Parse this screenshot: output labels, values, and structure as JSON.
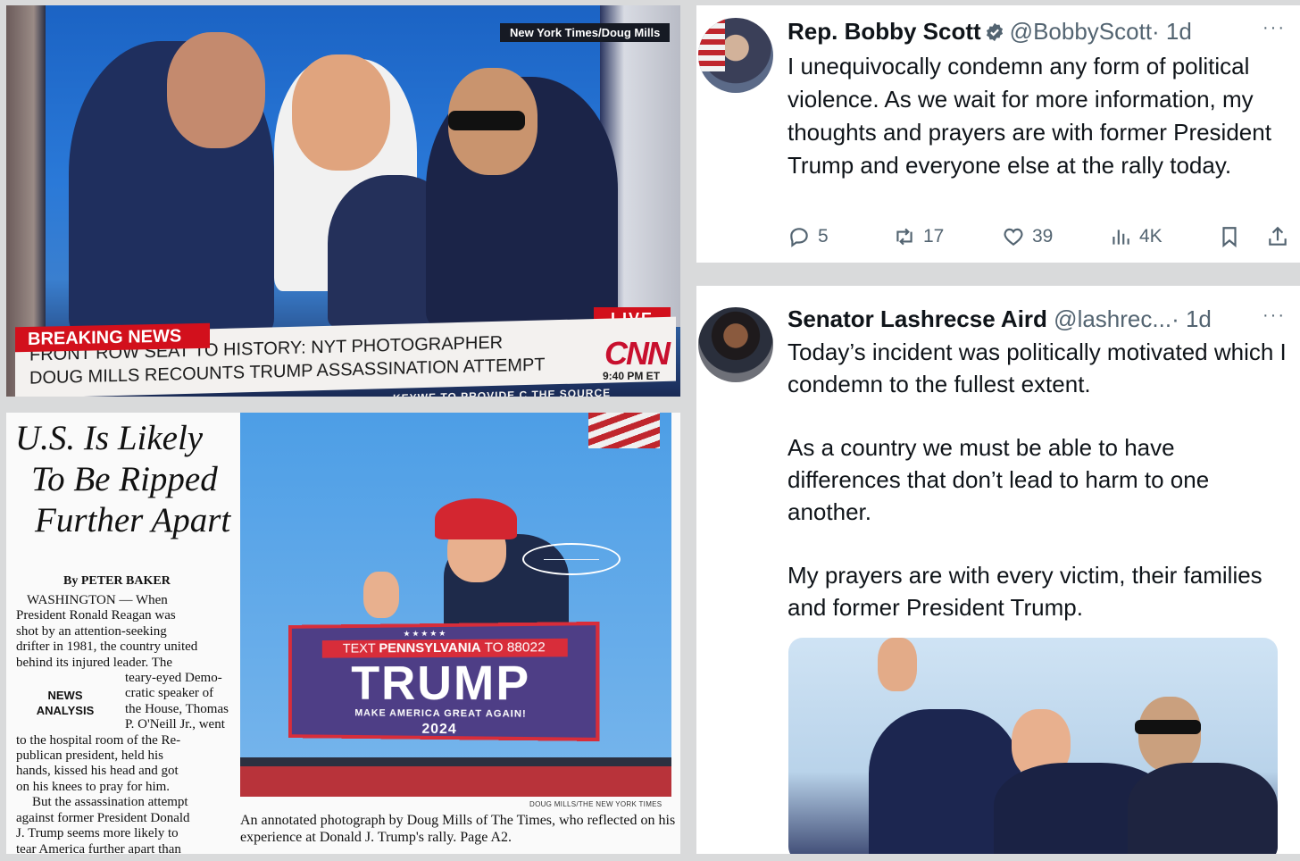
{
  "tv": {
    "credit": "New York Times/Doug Mills",
    "live": "LIVE",
    "breaking": "BREAKING NEWS",
    "headline_1": "FRONT ROW SEAT TO HISTORY: NYT PHOTOGRAPHER",
    "headline_2": "DOUG MILLS RECOUNTS TRUMP ASSASSINATION ATTEMPT",
    "network": "CNN",
    "time": "9:40 PM ET",
    "ticker": "…KEYWE TO PROVIDE C THE SOURCE"
  },
  "paper": {
    "headline": [
      "U.S. Is Likely",
      "To Be Ripped",
      "Further Apart"
    ],
    "byline": "By PETER BAKER",
    "section_tag": [
      "NEWS",
      "ANALYSIS"
    ],
    "body": [
      "WASHINGTON — When",
      "President Ronald Reagan was",
      "shot by an attention-seeking",
      "drifter in 1981, the country united",
      "behind its injured leader. The",
      "teary-eyed Demo-",
      "cratic speaker of",
      "the House, Thomas",
      "P. O'Neill Jr., went",
      "to the hospital room of the Re-",
      "publican president, held his",
      "hands, kissed his head and got",
      "on his knees to pray for him.",
      "But the assassination attempt",
      "against former President Donald",
      "J. Trump seems more likely to",
      "tear America further apart than"
    ],
    "podium": {
      "stars": "★★★★★",
      "text_prefix": "TEXT ",
      "text_state": "PENNSYLVANIA",
      "text_suffix": " TO 88022",
      "name": "TRUMP",
      "slogan": "MAKE AMERICA GREAT AGAIN!",
      "year": "2024"
    },
    "photo_credit": "DOUG MILLS/THE NEW YORK TIMES",
    "caption": "An annotated photograph by Doug Mills of The Times, who reflected on his experience at Donald J. Trump's rally. Page A2."
  },
  "tweets": [
    {
      "name": "Rep. Bobby Scott",
      "verified": true,
      "handle": "@BobbyScott",
      "time": "· 1d",
      "more": "···",
      "text": [
        "I unequivocally condemn any form of political violence. As we wait for more information, my thoughts and prayers are with former President Trump and everyone else at the rally today."
      ],
      "replies": "5",
      "reposts": "17",
      "likes": "39",
      "views": "4K"
    },
    {
      "name": "Senator Lashrecse Aird",
      "verified": false,
      "handle": "@lashrec...",
      "time": "· 1d",
      "more": "···",
      "text": [
        "Today’s incident was politically motivated which I condemn to the fullest extent.",
        "As a country we must be able to have differences that don’t lead to harm to one another.",
        "My prayers are with every victim, their families and former President Trump."
      ]
    }
  ],
  "colors": {
    "cnn_red": "#d2101c",
    "podium_blue": "#4e3e86",
    "x_gray": "#536471",
    "verified_blue": "#536471"
  },
  "icons": [
    "reply-icon",
    "repost-icon",
    "like-icon",
    "views-icon",
    "bookmark-icon",
    "share-icon",
    "verified-icon",
    "more-icon"
  ]
}
